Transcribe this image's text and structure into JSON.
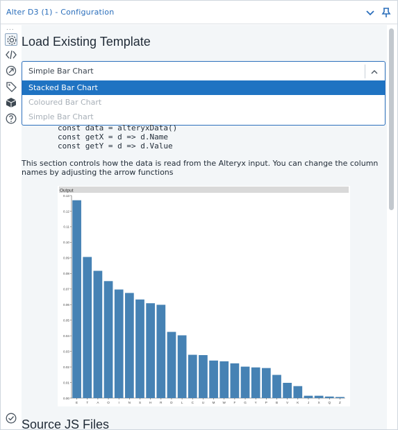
{
  "window": {
    "title": "Alter D3 (1) - Configuration",
    "icons": {
      "collapse": "chevron-down-icon",
      "pin": "pin-icon"
    }
  },
  "rail": {
    "more": "...",
    "items": [
      {
        "icon": "gear-icon",
        "active": true
      },
      {
        "icon": "code-icon",
        "active": false
      },
      {
        "icon": "target-icon",
        "active": false
      },
      {
        "icon": "tag-icon",
        "active": false
      },
      {
        "icon": "cube-icon",
        "active": false
      },
      {
        "icon": "help-icon",
        "active": false
      },
      {
        "icon": "check-circle-icon",
        "active": false
      }
    ]
  },
  "main": {
    "heading": "Load Existing Template",
    "template_select": {
      "value": "Simple Bar Chart",
      "options": [
        {
          "label": "Stacked Bar Chart",
          "state": "selected"
        },
        {
          "label": "Coloured Bar Chart",
          "state": "disabled"
        },
        {
          "label": "Simple Bar Chart",
          "state": "disabled"
        }
      ]
    },
    "code_lines": [
      "const data = alteryxData()",
      "const getX = d => d.Name",
      "const getY = d => d.Value"
    ],
    "description": "This section controls how the data is read from the Alteryx input. You can change the column names by adjusting the arrow functions",
    "next_heading": "Source JS Files"
  },
  "colors": {
    "accent": "#2a6ebb",
    "bar": "#4682b4",
    "selected_option": "#1f73c2"
  },
  "chart_data": {
    "type": "bar",
    "title": "Output",
    "categories": [
      "E",
      "T",
      "A",
      "O",
      "I",
      "N",
      "S",
      "H",
      "R",
      "D",
      "L",
      "C",
      "U",
      "M",
      "W",
      "F",
      "G",
      "Y",
      "P",
      "B",
      "V",
      "K",
      "J",
      "X",
      "Q",
      "Z"
    ],
    "values": [
      0.127,
      0.0906,
      0.0817,
      0.0751,
      0.0697,
      0.0675,
      0.0633,
      0.0609,
      0.0599,
      0.0425,
      0.0403,
      0.0278,
      0.0276,
      0.0241,
      0.0236,
      0.0223,
      0.0202,
      0.0197,
      0.0193,
      0.0149,
      0.0098,
      0.0077,
      0.0015,
      0.0015,
      0.001,
      0.0007
    ],
    "yticks": [
      "0.00",
      "0.01",
      "0.02",
      "0.03",
      "0.04",
      "0.05",
      "0.06",
      "0.07",
      "0.08",
      "0.09",
      "0.10",
      "0.11",
      "0.12",
      "0.13"
    ],
    "ylim": [
      0,
      0.13
    ],
    "xlabel": "",
    "ylabel": "",
    "grid": false,
    "legend": "none"
  }
}
